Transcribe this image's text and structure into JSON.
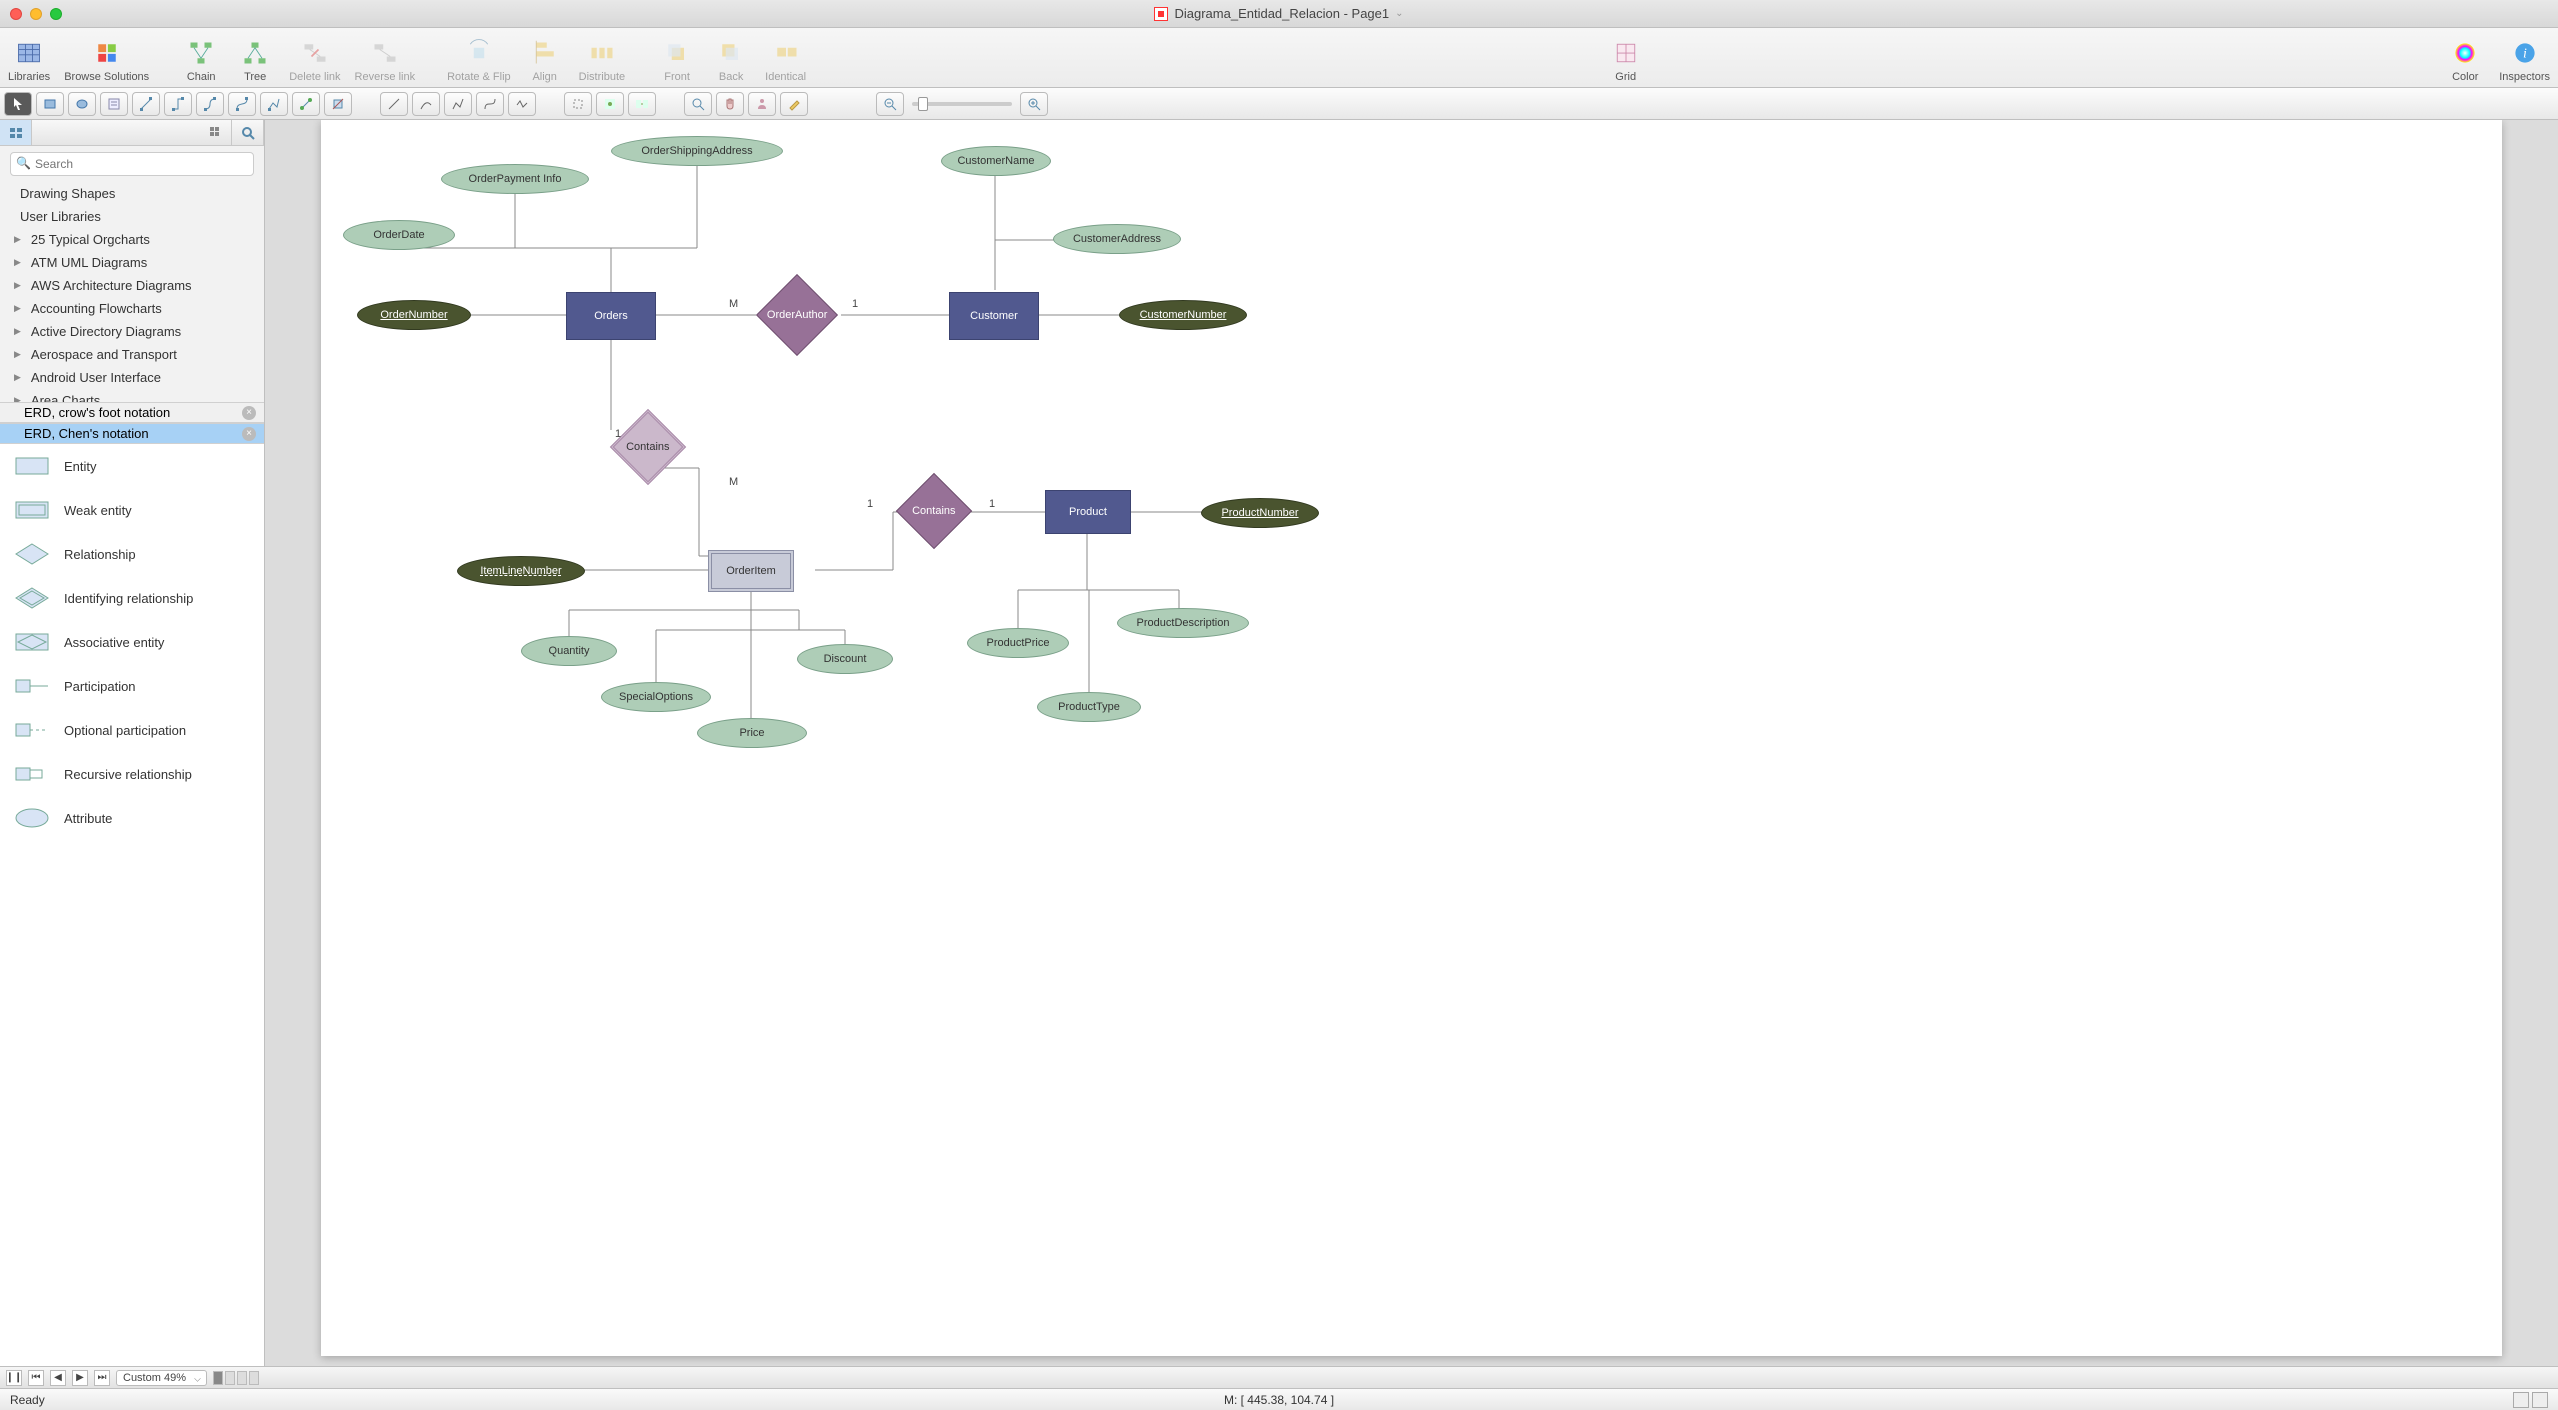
{
  "titlebar": {
    "title": "Diagrama_Entidad_Relacion - Page1"
  },
  "toolbar": {
    "libraries": "Libraries",
    "browse": "Browse Solutions",
    "chain": "Chain",
    "tree": "Tree",
    "delete_link": "Delete link",
    "reverse_link": "Reverse link",
    "rotate_flip": "Rotate & Flip",
    "align": "Align",
    "distribute": "Distribute",
    "front": "Front",
    "back": "Back",
    "identical": "Identical",
    "grid": "Grid",
    "color": "Color",
    "inspectors": "Inspectors"
  },
  "sidebar": {
    "search_placeholder": "Search",
    "categories": [
      "Drawing Shapes",
      "User Libraries"
    ],
    "libs": [
      "25 Typical Orgcharts",
      "ATM UML Diagrams",
      "AWS Architecture Diagrams",
      "Accounting Flowcharts",
      "Active Directory Diagrams",
      "Aerospace and Transport",
      "Android User Interface",
      "Area Charts"
    ],
    "selected_libs": {
      "crow": "ERD, crow's foot notation",
      "chen": "ERD, Chen's notation"
    },
    "shapes": [
      "Entity",
      "Weak entity",
      "Relationship",
      "Identifying relationship",
      "Associative entity",
      "Participation",
      "Optional participation",
      "Recursive relationship",
      "Attribute"
    ]
  },
  "diagram": {
    "entities": {
      "orders": "Orders",
      "customer": "Customer",
      "orderitem": "OrderItem",
      "product": "Product"
    },
    "relationships": {
      "orderauthor": "OrderAuthor",
      "contains1": "Contains",
      "contains2": "Contains"
    },
    "attributes": {
      "orderdate": "OrderDate",
      "orderpayment": "OrderPayment Info",
      "ordershipping": "OrderShippingAddress",
      "ordernumber": "OrderNumber",
      "customername": "CustomerName",
      "customeraddress": "CustomerAddress",
      "customernumber": "CustomerNumber",
      "itemline": "ItemLineNumber",
      "quantity": "Quantity",
      "specialoptions": "SpecialOptions",
      "price": "Price",
      "discount": "Discount",
      "productnumber": "ProductNumber",
      "productdescription": "ProductDescription",
      "productprice": "ProductPrice",
      "producttype": "ProductType"
    },
    "cardinalities": {
      "m": "M",
      "one": "1"
    }
  },
  "bottom": {
    "zoom_label": "Custom 49%",
    "mouse": "M: [ 445.38, 104.74 ]"
  },
  "status": {
    "ready": "Ready"
  }
}
